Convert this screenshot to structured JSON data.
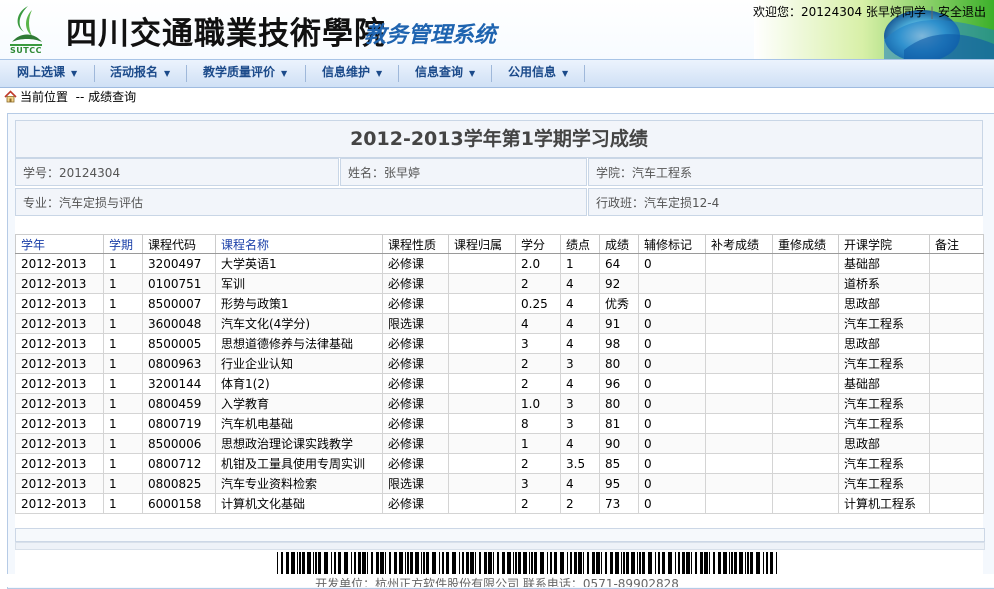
{
  "header": {
    "logo_abbr": "SUTCC",
    "school_name": "四川交通職業技術學院",
    "system_name": "教务管理系统",
    "welcome": "欢迎您：20124304 张早婷同学",
    "separator": "|",
    "logout": "安全退出"
  },
  "nav": {
    "items": [
      {
        "label": "网上选课"
      },
      {
        "label": "活动报名"
      },
      {
        "label": "教学质量评价"
      },
      {
        "label": "信息维护"
      },
      {
        "label": "信息查询"
      },
      {
        "label": "公用信息"
      }
    ]
  },
  "breadcrumb": {
    "label": "当前位置",
    "path": "-- 成绩查询"
  },
  "report": {
    "title": "2012-2013学年第1学期学习成绩",
    "student_id": "学号：20124304",
    "name": "姓名：张早婷",
    "college": "学院：汽车工程系",
    "major": "专业：汽车定损与评估",
    "class": "行政班：汽车定损12-4"
  },
  "table": {
    "headers": [
      "学年",
      "学期",
      "课程代码",
      "课程名称",
      "课程性质",
      "课程归属",
      "学分",
      "绩点",
      "成绩",
      "辅修标记",
      "补考成绩",
      "重修成绩",
      "开课学院",
      "备注"
    ],
    "rows": [
      [
        "2012-2013",
        "1",
        "3200497",
        "大学英语1",
        "必修课",
        "",
        "2.0",
        "1",
        "64",
        "0",
        "",
        "",
        "基础部",
        ""
      ],
      [
        "2012-2013",
        "1",
        "0100751",
        "军训",
        "必修课",
        "",
        "2",
        "4",
        "92",
        "",
        "",
        "",
        "道桥系",
        ""
      ],
      [
        "2012-2013",
        "1",
        "8500007",
        "形势与政策1",
        "必修课",
        "",
        "0.25",
        "4",
        "优秀",
        "0",
        "",
        "",
        "思政部",
        ""
      ],
      [
        "2012-2013",
        "1",
        "3600048",
        "汽车文化(4学分)",
        "限选课",
        "",
        "4",
        "4",
        "91",
        "0",
        "",
        "",
        "汽车工程系",
        ""
      ],
      [
        "2012-2013",
        "1",
        "8500005",
        "思想道德修养与法律基础",
        "必修课",
        "",
        "3",
        "4",
        "98",
        "0",
        "",
        "",
        "思政部",
        ""
      ],
      [
        "2012-2013",
        "1",
        "0800963",
        "行业企业认知",
        "必修课",
        "",
        "2",
        "3",
        "80",
        "0",
        "",
        "",
        "汽车工程系",
        ""
      ],
      [
        "2012-2013",
        "1",
        "3200144",
        "体育1(2)",
        "必修课",
        "",
        "2",
        "4",
        "96",
        "0",
        "",
        "",
        "基础部",
        ""
      ],
      [
        "2012-2013",
        "1",
        "0800459",
        "入学教育",
        "必修课",
        "",
        "1.0",
        "3",
        "80",
        "0",
        "",
        "",
        "汽车工程系",
        ""
      ],
      [
        "2012-2013",
        "1",
        "0800719",
        "汽车机电基础",
        "必修课",
        "",
        "8",
        "3",
        "81",
        "0",
        "",
        "",
        "汽车工程系",
        ""
      ],
      [
        "2012-2013",
        "1",
        "8500006",
        "思想政治理论课实践教学",
        "必修课",
        "",
        "1",
        "4",
        "90",
        "0",
        "",
        "",
        "思政部",
        ""
      ],
      [
        "2012-2013",
        "1",
        "0800712",
        "机钳及工量具使用专周实训",
        "必修课",
        "",
        "2",
        "3.5",
        "85",
        "0",
        "",
        "",
        "汽车工程系",
        ""
      ],
      [
        "2012-2013",
        "1",
        "0800825",
        "汽车专业资料检索",
        "限选课",
        "",
        "3",
        "4",
        "95",
        "0",
        "",
        "",
        "汽车工程系",
        ""
      ],
      [
        "2012-2013",
        "1",
        "6000158",
        "计算机文化基础",
        "必修课",
        "",
        "2",
        "2",
        "73",
        "0",
        "",
        "",
        "计算机工程系",
        ""
      ]
    ]
  },
  "footer": {
    "text": "开发单位：杭州正方软件股份有限公司  联系电话：0571-89902828"
  },
  "colors": {
    "nav_text": "#1b4a8a",
    "system_name": "#1f64b0",
    "link_header": "#1a3fa8",
    "panel_border": "#b6cbe6"
  }
}
